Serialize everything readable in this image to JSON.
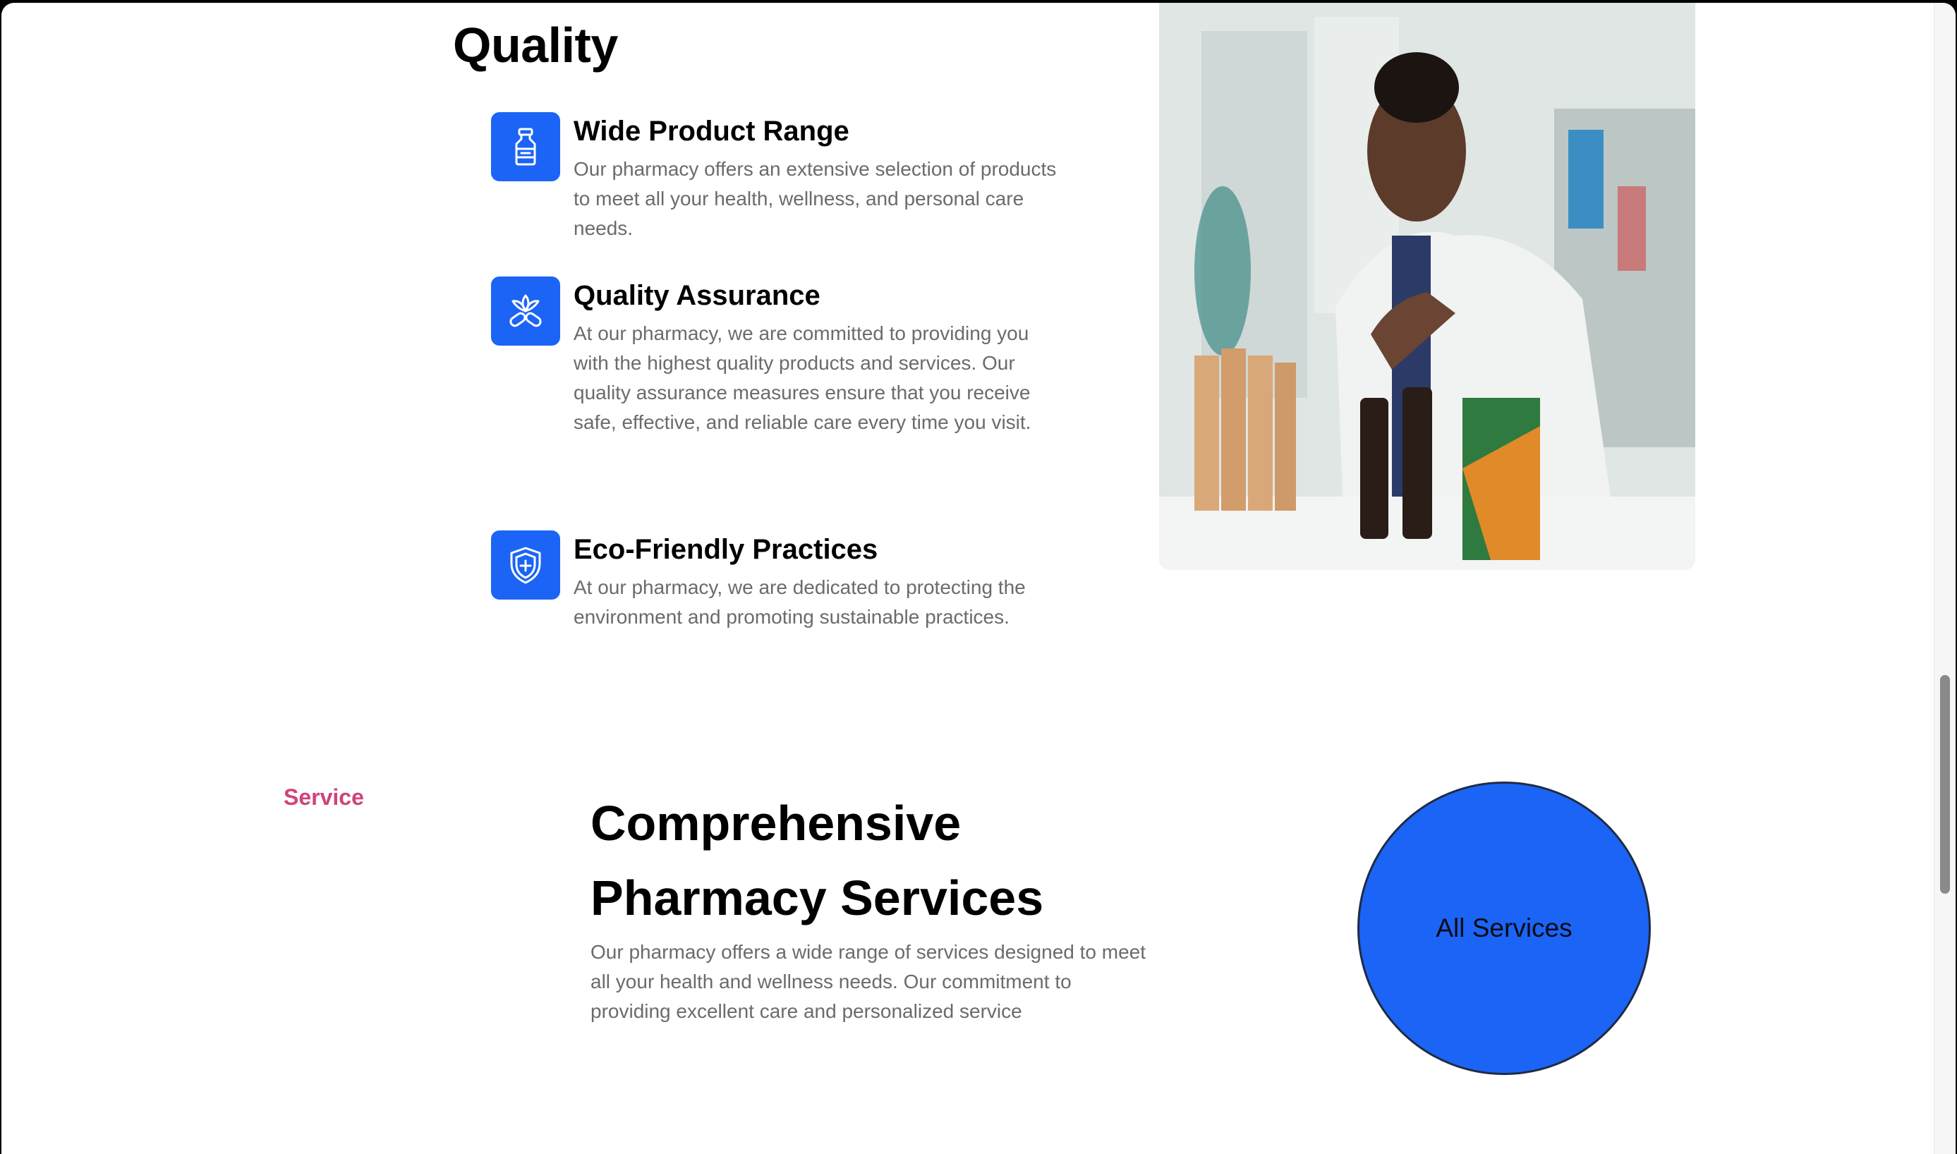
{
  "quality_section": {
    "title": "Quality",
    "features": [
      {
        "icon": "medicine-bottle-icon",
        "title": "Wide Product Range",
        "description": "Our pharmacy offers an extensive selection of products to meet all your health, wellness, and personal care needs."
      },
      {
        "icon": "pills-flower-icon",
        "title": "Quality Assurance",
        "description": "At our pharmacy, we are committed to providing you with the highest quality products and services. Our quality assurance measures ensure that you receive safe, effective, and reliable care every time you visit."
      },
      {
        "icon": "shield-plus-icon",
        "title": "Eco-Friendly Practices",
        "description": "At our pharmacy, we are dedicated to protecting the environment and promoting sustainable practices."
      }
    ],
    "image_description": "pharmacist-arranging-products"
  },
  "service_section": {
    "kicker": "Service",
    "heading": "Comprehensive Pharmacy Services",
    "description": "Our pharmacy offers a wide range of services designed to meet all your health and wellness needs. Our commitment to providing excellent care and personalized service",
    "cta_label": "All Services"
  },
  "colors": {
    "accent_blue": "#1b64f5",
    "kicker_pink": "#d0437a",
    "body_text": "#6b6b6b"
  }
}
